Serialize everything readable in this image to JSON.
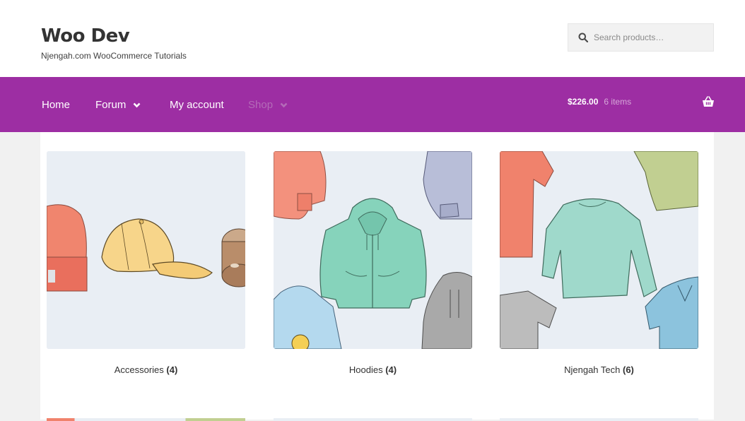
{
  "site": {
    "title": "Woo Dev",
    "tagline": "Njengah.com WooCommerce Tutorials"
  },
  "search": {
    "placeholder": "Search products…",
    "icon": "search-icon"
  },
  "nav": {
    "items": [
      {
        "label": "Home",
        "has_dropdown": false
      },
      {
        "label": "Forum",
        "has_dropdown": true
      },
      {
        "label": "My account",
        "has_dropdown": false
      },
      {
        "label": "Shop",
        "has_dropdown": true
      }
    ]
  },
  "cart": {
    "total": "$226.00",
    "count": "6 items",
    "icon": "basket-icon"
  },
  "colors": {
    "nav_bg": "#9d2ea3",
    "page_bg": "#f1f1f1",
    "thumb_bg": "#e9eef4"
  },
  "categories": [
    {
      "name": "Accessories",
      "count": "(4)"
    },
    {
      "name": "Hoodies",
      "count": "(4)"
    },
    {
      "name": "Njengah Tech",
      "count": "(6)"
    }
  ]
}
